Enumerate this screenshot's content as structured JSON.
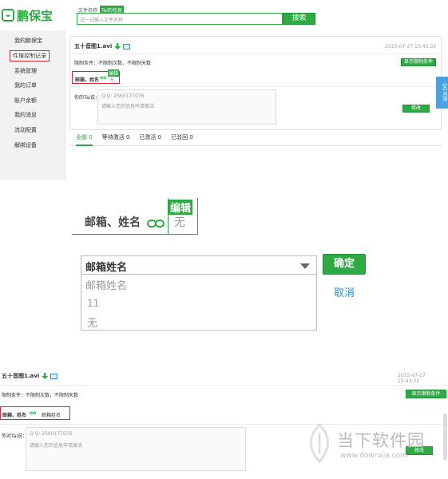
{
  "brand": {
    "logo_text": "鹏保宝",
    "accent": "#2eaa45"
  },
  "top": {
    "tabs": [
      "文件名称",
      "Tai的信息"
    ],
    "search_placeholder": "试一试输入文件名称",
    "search_button": "搜索"
  },
  "sidebar": {
    "items": [
      {
        "label": "我的鹏保宝"
      },
      {
        "label": "件搜控制记录"
      },
      {
        "label": "系统管理"
      },
      {
        "label": "我的订单"
      },
      {
        "label": "账户余额"
      },
      {
        "label": "我的消息"
      },
      {
        "label": "流动配置"
      },
      {
        "label": "解绑设备"
      }
    ]
  },
  "record": {
    "filename": "五十音图1.avi",
    "timestamp": "2015-07-27 15:43:33",
    "limit_text": "限制条件：不限制次数，不限制天数",
    "show_limits_button": "显示限制条件",
    "email_name_label": "邮箱，姓名",
    "edit_badge": "编辑",
    "value_none": "无",
    "your_tai_label": "你的Tai说：",
    "qq_line": "Q Q: 2560177076",
    "message_placeholder": "请输入您的信息申请激活",
    "modify_button": "修改",
    "side_tab": "QQ 咨询"
  },
  "filters": {
    "tabs": [
      {
        "label": "全部",
        "count": "0"
      },
      {
        "label": "等待激活",
        "count": "0"
      },
      {
        "label": "已激活",
        "count": "0"
      },
      {
        "label": "已驳回",
        "count": "0"
      }
    ]
  },
  "zoom_a": {
    "label": "邮箱、姓名",
    "edit_badge": "编辑",
    "value": "无"
  },
  "zoom_b": {
    "select_value": "邮箱姓名",
    "options": [
      "邮箱姓名",
      "11",
      "无"
    ],
    "confirm_button": "确定",
    "cancel_link": "取消"
  },
  "result": {
    "filename": "五十音图1.avi",
    "timestamp": "2015-07-27 15:43:33",
    "limit_text": "限制条件：不限制次数，不限制天数",
    "show_limits_button": "显示限制条件",
    "email_name_label": "邮箱、姓名",
    "value": "邮箱姓名",
    "your_tai_label": "你对Tai说：",
    "qq_line": "Q Q: 2560177076",
    "message_placeholder": "请输入您的信息申请激活",
    "modify_button": "修改"
  },
  "watermark": {
    "cn": "当下软件园",
    "url": "www.downxia.com"
  }
}
